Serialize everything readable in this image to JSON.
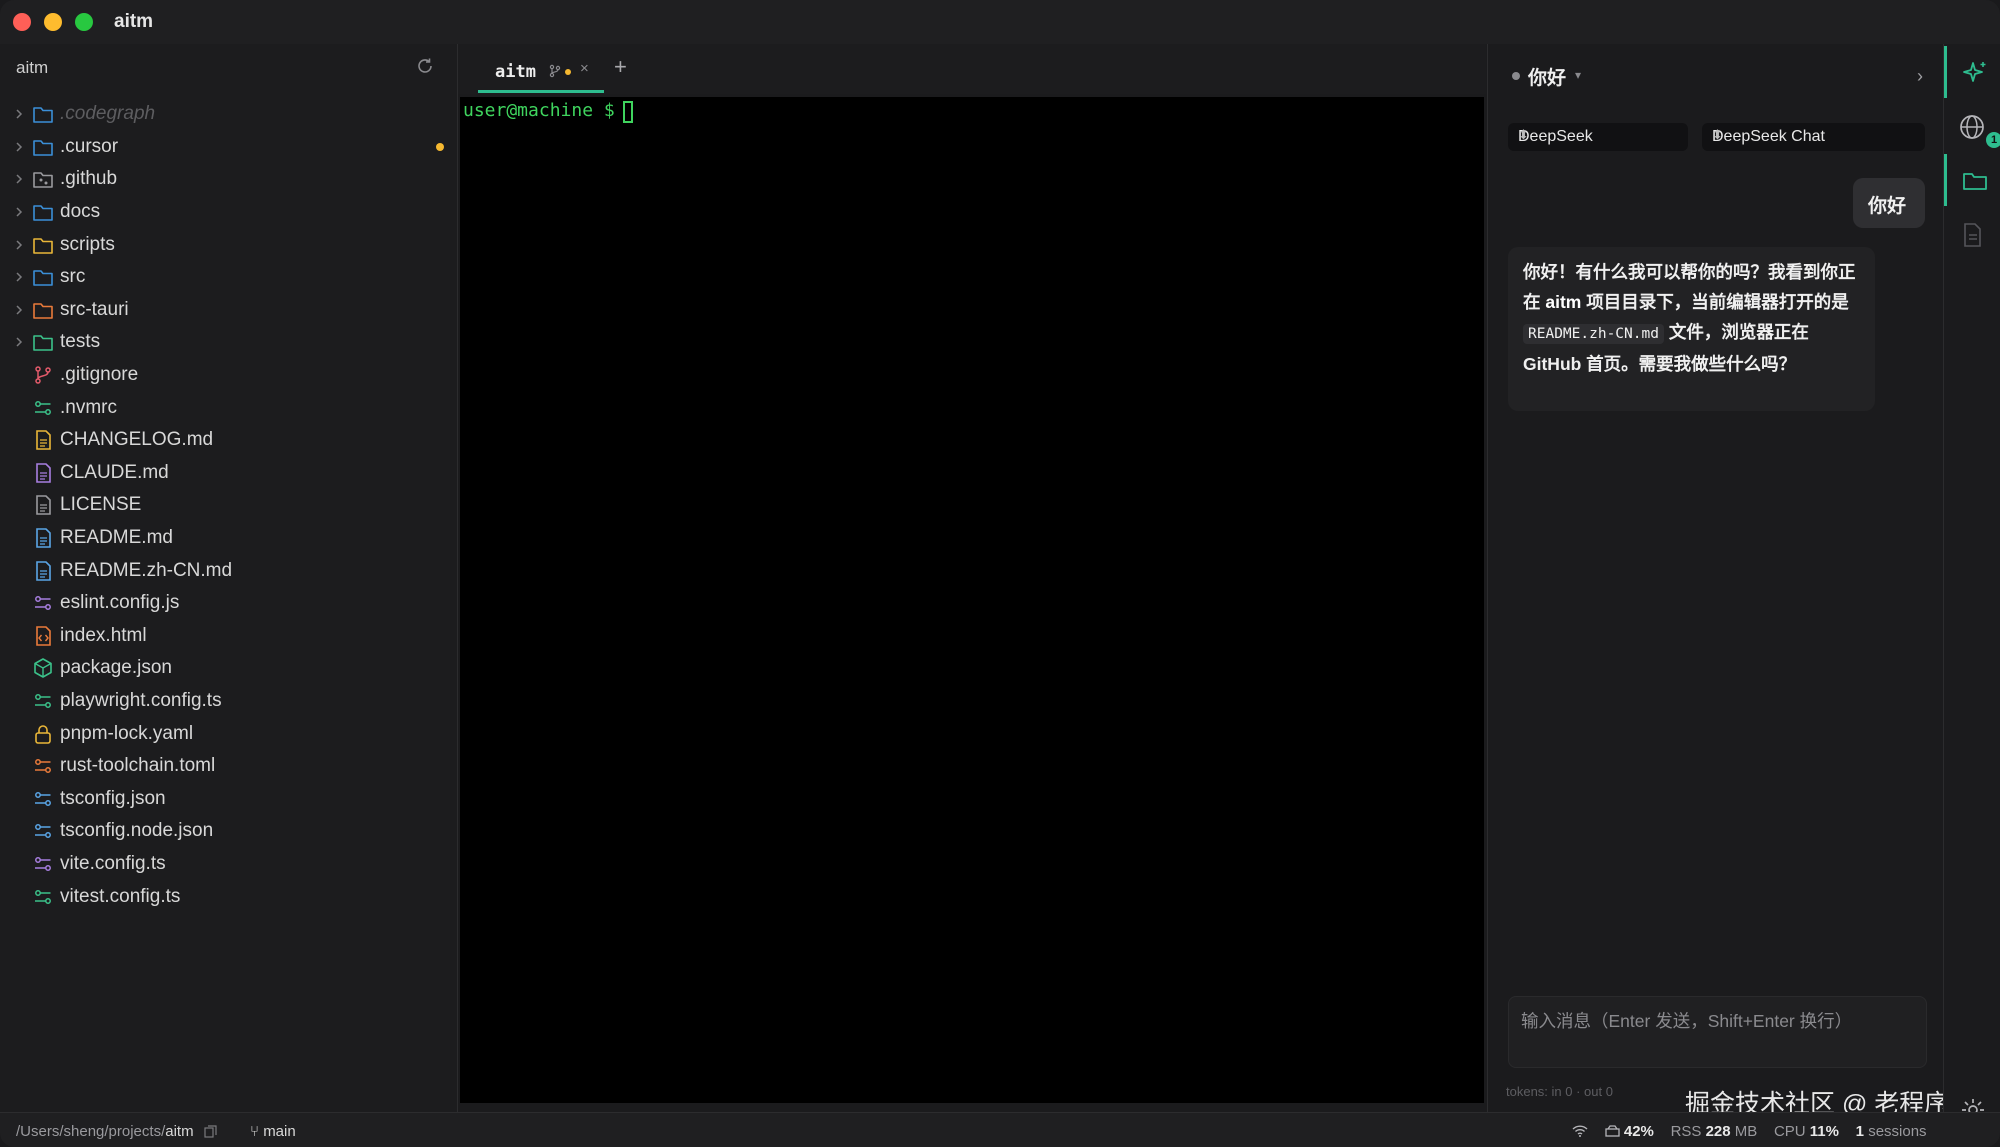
{
  "window": {
    "title": "aitm"
  },
  "sidebar": {
    "header": "aitm",
    "items": [
      {
        "name": ".codegraph",
        "type": "folder",
        "color": "#3b8fd8",
        "dim": true,
        "expandable": true
      },
      {
        "name": ".cursor",
        "type": "folder",
        "color": "#3b8fd8",
        "expandable": true,
        "modified": true
      },
      {
        "name": ".github",
        "type": "folder-git",
        "color": "#9a9a9e",
        "expandable": true
      },
      {
        "name": "docs",
        "type": "folder",
        "color": "#3b8fd8",
        "expandable": true
      },
      {
        "name": "scripts",
        "type": "folder",
        "color": "#e9b638",
        "expandable": true
      },
      {
        "name": "src",
        "type": "folder",
        "color": "#3b8fd8",
        "expandable": true
      },
      {
        "name": "src-tauri",
        "type": "folder",
        "color": "#e97a3a",
        "expandable": true
      },
      {
        "name": "tests",
        "type": "folder",
        "color": "#3bc28a",
        "expandable": true
      },
      {
        "name": ".gitignore",
        "type": "git-icon",
        "color": "#e25a6a"
      },
      {
        "name": ".nvmrc",
        "type": "config-icon",
        "color": "#3bc28a"
      },
      {
        "name": "CHANGELOG.md",
        "type": "doc-icon",
        "color": "#e9b638"
      },
      {
        "name": "CLAUDE.md",
        "type": "doc-icon",
        "color": "#a77ee0"
      },
      {
        "name": "LICENSE",
        "type": "doc-icon",
        "color": "#9a9a9e"
      },
      {
        "name": "README.md",
        "type": "doc-icon",
        "color": "#5aa5e6"
      },
      {
        "name": "README.zh-CN.md",
        "type": "doc-icon",
        "color": "#5aa5e6"
      },
      {
        "name": "eslint.config.js",
        "type": "config-icon",
        "color": "#a77ee0"
      },
      {
        "name": "index.html",
        "type": "code-icon",
        "color": "#e97a3a"
      },
      {
        "name": "package.json",
        "type": "package-icon",
        "color": "#3bc28a"
      },
      {
        "name": "playwright.config.ts",
        "type": "config-icon",
        "color": "#3bc28a"
      },
      {
        "name": "pnpm-lock.yaml",
        "type": "lock-icon",
        "color": "#e9b638"
      },
      {
        "name": "rust-toolchain.toml",
        "type": "config-icon",
        "color": "#e97a3a"
      },
      {
        "name": "tsconfig.json",
        "type": "config-icon",
        "color": "#5aa5e6"
      },
      {
        "name": "tsconfig.node.json",
        "type": "config-icon",
        "color": "#5aa5e6"
      },
      {
        "name": "vite.config.ts",
        "type": "config-icon",
        "color": "#a77ee0"
      },
      {
        "name": "vitest.config.ts",
        "type": "config-icon",
        "color": "#3bc28a"
      }
    ]
  },
  "editor": {
    "tabs": [
      {
        "label": "aitm",
        "close": "×"
      }
    ],
    "add_tab": "+",
    "terminal_prompt": "user@machine $"
  },
  "chat": {
    "title": "你好",
    "provider": "DeepSeek",
    "model": "DeepSeek Chat",
    "user_message": "你好",
    "ai_message": {
      "part1": "你好！有什么我可以帮你的吗？我看到你正在 ",
      "bold": "aitm",
      "part2": " 项目目录下，当前编辑器打开的是 ",
      "code": "README.zh-CN.md",
      "part3": " 文件，浏览器正在 GitHub 首页。需要我做些什么吗？"
    },
    "input_placeholder": "输入消息（Enter 发送，Shift+Enter 换行）",
    "tokens": "tokens: in 0 · out 0",
    "watermark": "掘金技术社区 @ 老程序猿"
  },
  "activity": {
    "badge": "1"
  },
  "statusbar": {
    "path_prefix": "/Users/sheng/projects/",
    "path_name": "aitm",
    "branch": "main",
    "disk_pct": "42%",
    "rss_label": "RSS",
    "rss_value": "228",
    "rss_unit": "MB",
    "cpu_label": "CPU",
    "cpu_value": "11%",
    "sessions_value": "1",
    "sessions_label": "sessions"
  },
  "colors": {
    "accent": "#2ebd8f",
    "prompt": "#3fd45e",
    "modified": "#f5b830"
  }
}
